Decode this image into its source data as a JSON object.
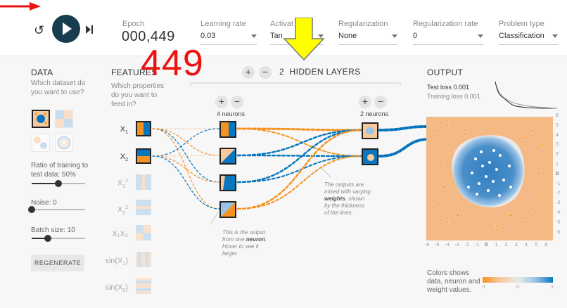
{
  "toolbar": {
    "reset_icon": "reset-icon",
    "play_icon": "play-icon",
    "step_icon": "step-icon",
    "epoch_label": "Epoch",
    "epoch_value": "000,449",
    "learning_rate_label": "Learning rate",
    "learning_rate_value": "0.03",
    "activation_label": "Activat",
    "activation_value": "Tan",
    "regularization_label": "Regularization",
    "regularization_value": "None",
    "reg_rate_label": "Regularization rate",
    "reg_rate_value": "0",
    "problem_type_label": "Problem type",
    "problem_type_value": "Classification"
  },
  "annotations": {
    "epoch_callout": "449",
    "red_color": "#ee1111",
    "yellow_color": "#ffff00"
  },
  "data_panel": {
    "title": "DATA",
    "subtitle_1": "Which dataset do",
    "subtitle_2": "you want to use?",
    "ratio_label_1": "Ratio of training to",
    "ratio_label_2": "test data:  50%",
    "ratio_value": 0.5,
    "noise_label": "Noise:  0",
    "noise_value": 0,
    "batch_label": "Batch size:  10",
    "batch_value": 0.3,
    "regenerate_label": "REGENERATE"
  },
  "features": {
    "title": "FEATURES",
    "subtitle_1": "Which properties",
    "subtitle_2": "do you want to",
    "subtitle_3": "feed in?",
    "items": [
      {
        "base": "X",
        "sub": "1",
        "sup": ""
      },
      {
        "base": "X",
        "sub": "2",
        "sup": ""
      },
      {
        "base": "X",
        "sub": "1",
        "sup": "2"
      },
      {
        "base": "X",
        "sub": "2",
        "sup": "2"
      },
      {
        "base": "X₁X₂",
        "sub": "",
        "sup": ""
      },
      {
        "base": "sin(X",
        "sub": "1",
        "sup": ""
      },
      {
        "base": "sin(X",
        "sub": "2",
        "sup": ""
      }
    ]
  },
  "layers": {
    "plus": "+",
    "minus": "−",
    "count": "2",
    "title": "HIDDEN LAYERS",
    "layer1_neurons": "4 neurons",
    "layer2_neurons": "2 neurons",
    "note_weights": [
      "The outputs are",
      "mixed with varying",
      "weights",
      ", shown",
      "by the thickness",
      "of the lines."
    ],
    "note_neuron": [
      "This is the output",
      "from one ",
      "neuron",
      ".",
      "Hover to see it",
      "larger."
    ]
  },
  "output": {
    "title": "OUTPUT",
    "test_loss": "Test loss 0.001",
    "training_loss": "Training loss 0.001",
    "x_ticks": [
      "-6",
      "-5",
      "-4",
      "-3",
      "-2",
      "-1",
      "0",
      "1",
      "2",
      "3",
      "4",
      "5",
      "6"
    ],
    "y_ticks": [
      "6",
      "5",
      "4",
      "3",
      "2",
      "1",
      "0",
      "-1",
      "-2",
      "-3",
      "-4",
      "-5",
      "-6"
    ],
    "legend_text_1": "Colors shows",
    "legend_text_2": "data, neuron and",
    "legend_text_3": "weight values.",
    "legend_min": "-1",
    "legend_mid": "0",
    "legend_max": "1",
    "orange": "#f59322",
    "blue": "#0877bd"
  }
}
